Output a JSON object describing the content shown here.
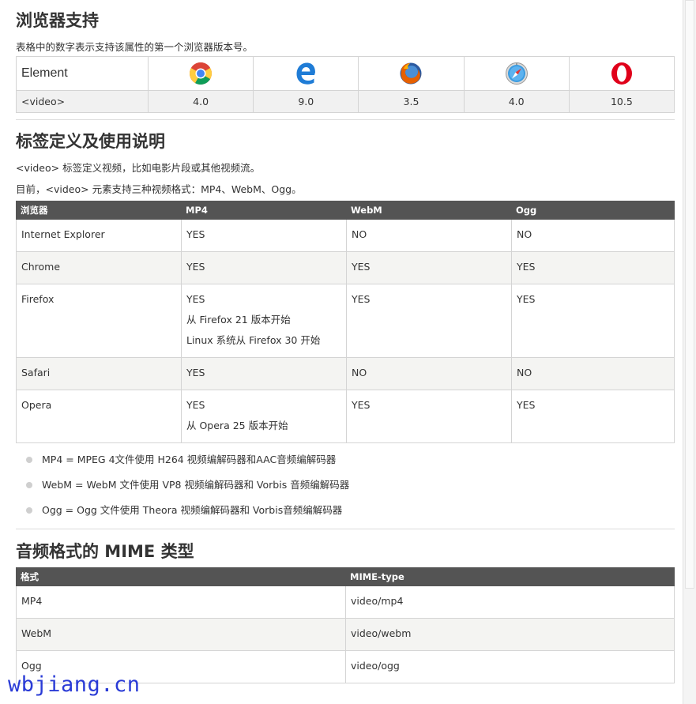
{
  "sections": {
    "support": {
      "title": "浏览器支持",
      "desc": "表格中的数字表示支持该属性的第一个浏览器版本号。",
      "element_header": "Element",
      "browsers": [
        {
          "icon": "chrome-icon",
          "name": "Chrome"
        },
        {
          "icon": "edge-icon",
          "name": "Edge"
        },
        {
          "icon": "firefox-icon",
          "name": "Firefox"
        },
        {
          "icon": "safari-icon",
          "name": "Safari"
        },
        {
          "icon": "opera-icon",
          "name": "Opera"
        }
      ],
      "row_label": "<video>",
      "versions": [
        "4.0",
        "9.0",
        "3.5",
        "4.0",
        "10.5"
      ]
    },
    "definition": {
      "title": "标签定义及使用说明",
      "line1": "<video> 标签定义视频，比如电影片段或其他视频流。",
      "line2": "目前，<video> 元素支持三种视频格式：MP4、WebM、Ogg。",
      "headers": [
        "浏览器",
        "MP4",
        "WebM",
        "Ogg"
      ],
      "rows": [
        {
          "browser": "Internet Explorer",
          "mp4": [
            "YES"
          ],
          "webm": "NO",
          "ogg": "NO"
        },
        {
          "browser": "Chrome",
          "mp4": [
            "YES"
          ],
          "webm": "YES",
          "ogg": "YES"
        },
        {
          "browser": "Firefox",
          "mp4": [
            "YES",
            "从 Firefox 21 版本开始",
            "Linux 系统从 Firefox 30 开始"
          ],
          "webm": "YES",
          "ogg": "YES"
        },
        {
          "browser": "Safari",
          "mp4": [
            "YES"
          ],
          "webm": "NO",
          "ogg": "NO"
        },
        {
          "browser": "Opera",
          "mp4": [
            "YES",
            "从 Opera 25 版本开始"
          ],
          "webm": "YES",
          "ogg": "YES"
        }
      ],
      "notes": [
        "MP4 = MPEG 4文件使用 H264 视频编解码器和AAC音频编解码器",
        "WebM = WebM 文件使用 VP8 视频编解码器和 Vorbis 音频编解码器",
        "Ogg = Ogg 文件使用 Theora 视频编解码器和 Vorbis音频编解码器"
      ]
    },
    "mime": {
      "title": "音频格式的 MIME 类型",
      "headers": [
        "格式",
        "MIME-type"
      ],
      "rows": [
        {
          "format": "MP4",
          "type": "video/mp4"
        },
        {
          "format": "WebM",
          "type": "video/webm"
        },
        {
          "format": "Ogg",
          "type": "video/ogg"
        }
      ]
    }
  },
  "watermark": "wbjiang.cn",
  "colors": {
    "header_bg": "#545454",
    "alt_row": "#f4f4f2",
    "watermark": "#2a3bd6"
  }
}
